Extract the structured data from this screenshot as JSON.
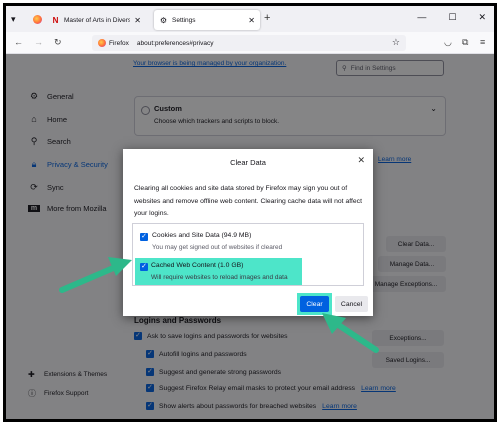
{
  "tabs": [
    {
      "label": "Master of Arts in Diverse Comm",
      "icon": "netflix-n-icon"
    },
    {
      "label": "Settings",
      "icon": "gear-icon"
    }
  ],
  "window_controls": [
    "minimize",
    "maximize",
    "close"
  ],
  "urlbar": {
    "identity": "Firefox",
    "url": "about:preferences#privacy"
  },
  "sidebar": {
    "items": [
      {
        "label": "General",
        "icon": "gear-icon"
      },
      {
        "label": "Home",
        "icon": "home-icon"
      },
      {
        "label": "Search",
        "icon": "search-icon"
      },
      {
        "label": "Privacy & Security",
        "icon": "lock-icon",
        "selected": true
      },
      {
        "label": "Sync",
        "icon": "sync-icon"
      },
      {
        "label": "More from Mozilla",
        "icon": "mozilla-m-icon"
      }
    ],
    "footer": [
      {
        "label": "Extensions & Themes",
        "icon": "puzzle-icon"
      },
      {
        "label": "Firefox Support",
        "icon": "help-icon"
      }
    ]
  },
  "prefs": {
    "policy_notice": "Your browser is being managed by your organization.",
    "find_placeholder": "Find in Settings",
    "custom_title": "Custom",
    "custom_desc": "Choose which trackers and scripts to block.",
    "learn_more": "Learn more",
    "buttons": {
      "clear_data": "Clear Data...",
      "manage_data": "Manage Data...",
      "manage_exceptions": "Manage Exceptions...",
      "exceptions": "Exceptions...",
      "saved_logins": "Saved Logins..."
    },
    "logins_heading": "Logins and Passwords",
    "logins_options": [
      "Ask to save logins and passwords for websites",
      "Autofill logins and passwords",
      "Suggest and generate strong passwords",
      "Suggest Firefox Relay email masks to protect your email address",
      "Show alerts about passwords for breached websites"
    ]
  },
  "dialog": {
    "title": "Clear Data",
    "description": "Clearing all cookies and site data stored by Firefox may sign you out of websites and remove offline web content. Clearing cache data will not affect your logins.",
    "options": [
      {
        "title": "Cookies and Site Data (94.9 MB)",
        "subtitle": "You may get signed out of websites if cleared",
        "checked": true
      },
      {
        "title": "Cached Web Content (1.0 GB)",
        "subtitle": "Will require websites to reload images and data",
        "checked": true
      }
    ],
    "clear_label": "Clear",
    "cancel_label": "Cancel"
  },
  "colors": {
    "accent": "#0061e0",
    "highlight": "#4de5c9",
    "arrow": "#2db88a"
  }
}
